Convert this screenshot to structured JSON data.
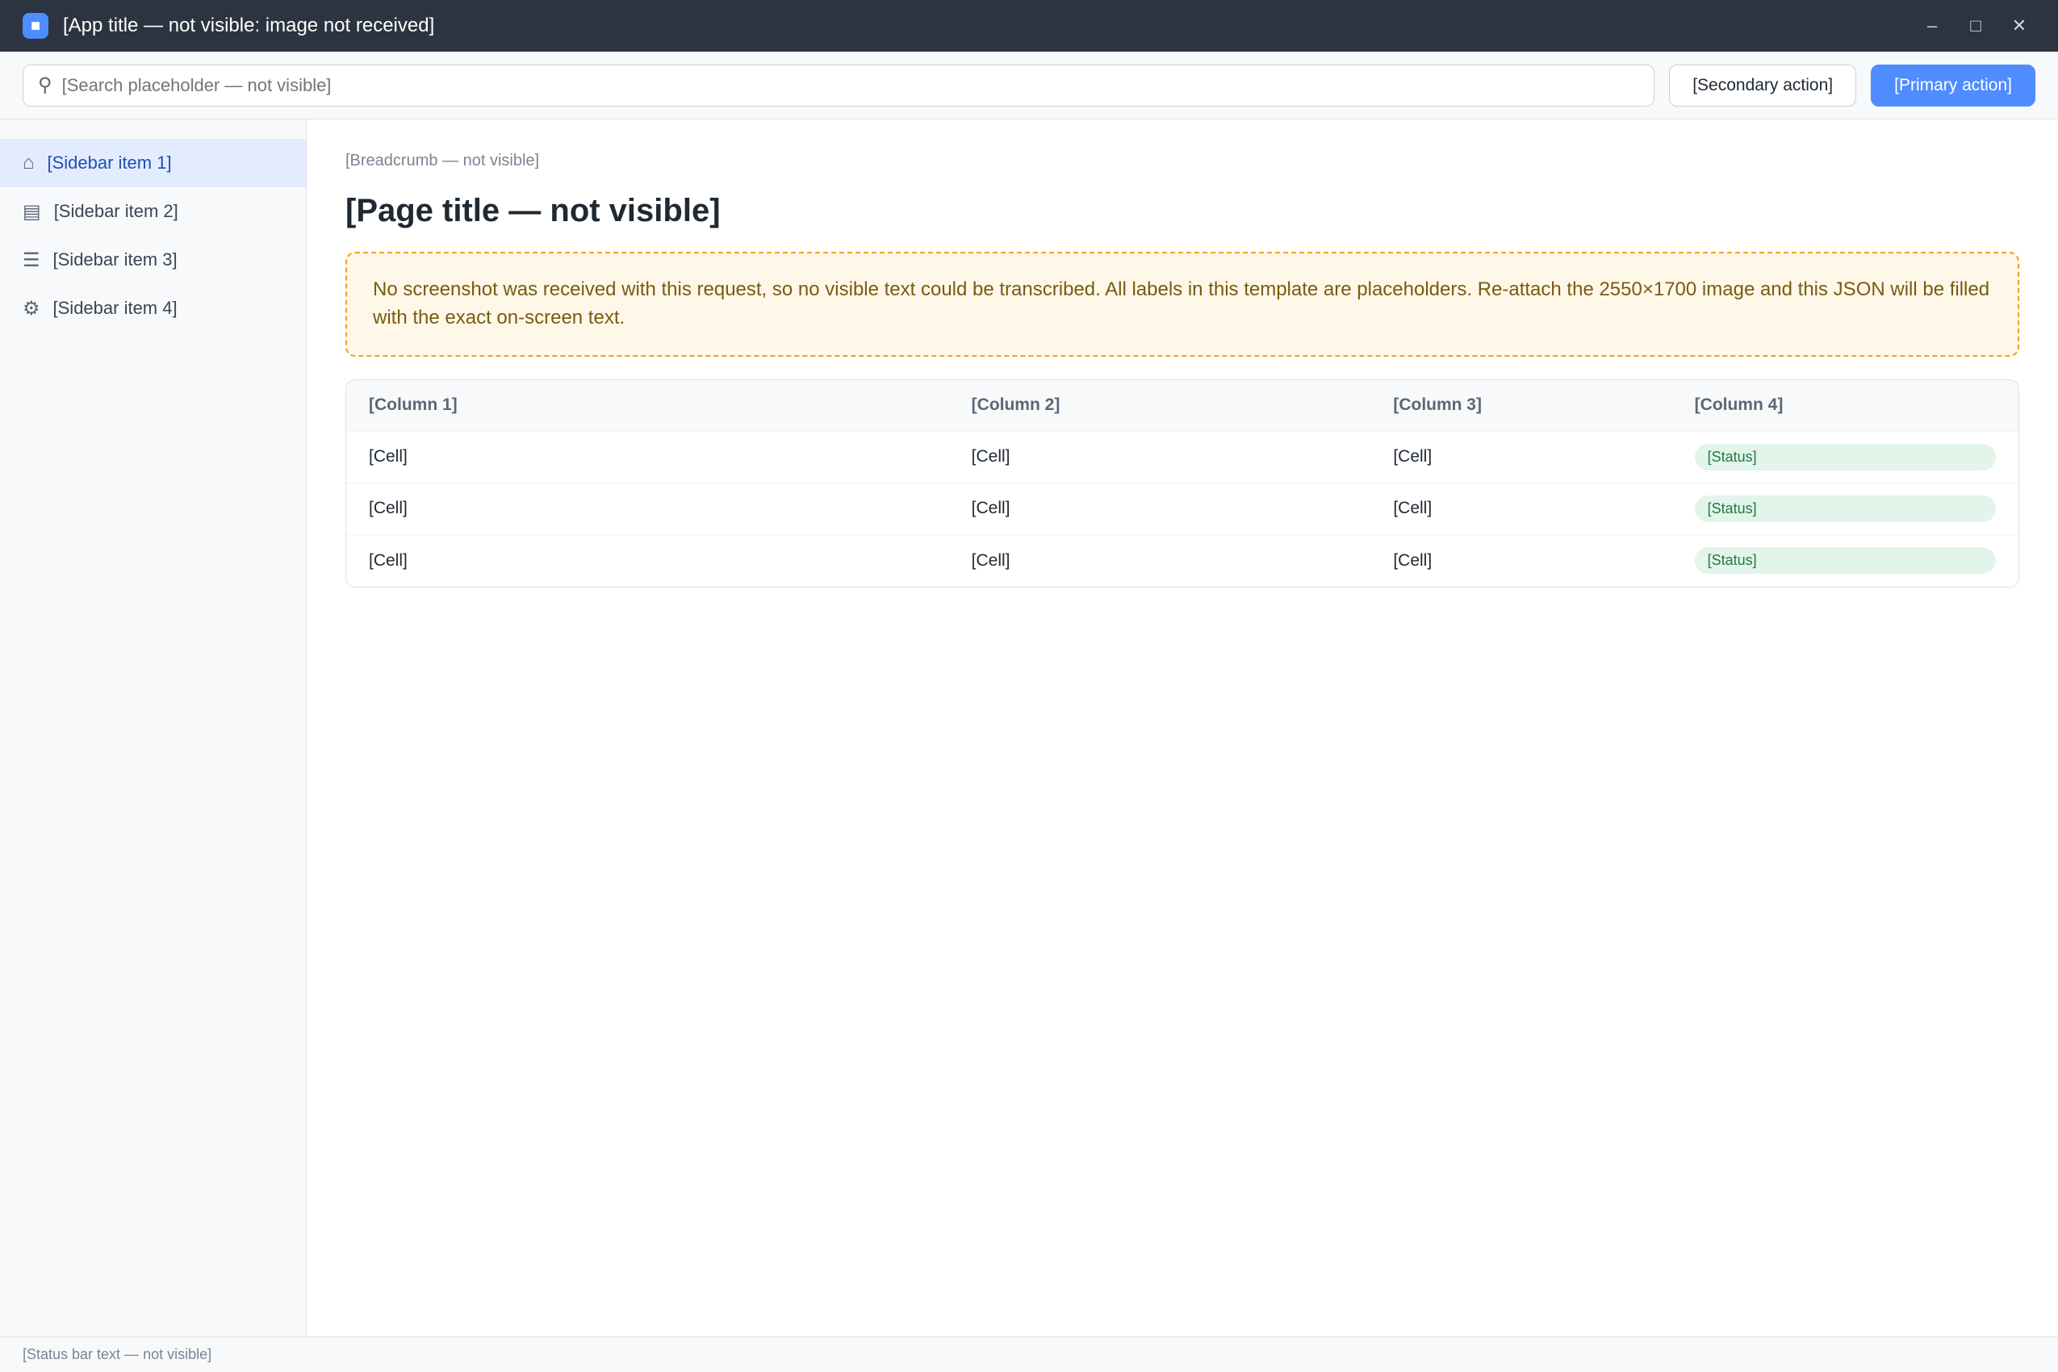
{
  "window": {
    "title": "[App title — not visible: image not received]"
  },
  "toolbar": {
    "search_placeholder": "[Search placeholder — not visible]",
    "primary_label": "[Primary action]",
    "secondary_label": "[Secondary action]"
  },
  "sidebar": {
    "items": [
      {
        "label": "[Sidebar item 1]"
      },
      {
        "label": "[Sidebar item 2]"
      },
      {
        "label": "[Sidebar item 3]"
      },
      {
        "label": "[Sidebar item 4]"
      }
    ]
  },
  "main": {
    "breadcrumb": "[Breadcrumb — not visible]",
    "title": "[Page title — not visible]",
    "notice": "No screenshot was received with this request, so no visible text could be transcribed. All labels in this template are placeholders. Re-attach the 2550×1700 image and this JSON will be filled with the exact on-screen text.",
    "table": {
      "headers": [
        "[Column 1]",
        "[Column 2]",
        "[Column 3]",
        "[Column 4]"
      ],
      "rows": [
        [
          "[Cell]",
          "[Cell]",
          "[Cell]",
          "[Status]"
        ],
        [
          "[Cell]",
          "[Cell]",
          "[Cell]",
          "[Status]"
        ],
        [
          "[Cell]",
          "[Cell]",
          "[Cell]",
          "[Status]"
        ]
      ]
    }
  },
  "statusbar": {
    "text": "[Status bar text — not visible]"
  },
  "colors": {
    "accent": "#4f8cff",
    "titlebar": "#2b3440"
  }
}
